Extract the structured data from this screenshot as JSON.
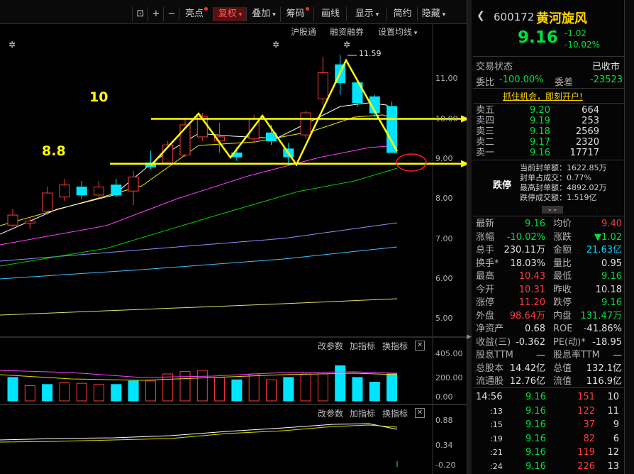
{
  "toolbar": {
    "items": [
      {
        "label": "亮点",
        "dot": true
      },
      {
        "label": "复权",
        "dropdown": true,
        "active": true
      },
      {
        "label": "叠加",
        "dropdown": true
      },
      {
        "label": "筹码",
        "dot": true
      },
      {
        "label": "画线"
      },
      {
        "label": "显示",
        "dropdown": true
      },
      {
        "label": "简约"
      },
      {
        "label": "隐藏",
        "dropdown": true
      }
    ],
    "subbar": [
      "沪股通",
      "融资融券",
      "设置均线"
    ]
  },
  "annotations": {
    "label_10": "10",
    "label_88": "8.8",
    "peak": "11.59"
  },
  "price_axis": [
    "11.00",
    "10.00",
    "9.00",
    "8.00",
    "7.00",
    "6.00",
    "5.00"
  ],
  "volume_panel": {
    "buttons": [
      "改参数",
      "加指标",
      "换指标"
    ],
    "axis": [
      "405.00",
      "200.00",
      "0.00"
    ]
  },
  "indicator_panel": {
    "buttons": [
      "改参数",
      "加指标",
      "换指标"
    ],
    "axis": [
      "0.88",
      "0.34",
      "-0.20"
    ]
  },
  "stock": {
    "code": "600172",
    "name": "黄河旋风",
    "price": "9.16",
    "change": "-1.02",
    "change_pct": "-10.02%",
    "status_label": "交易状态",
    "status": "已收市",
    "weibi_label": "委比",
    "weibi": "-100.00%",
    "weicha_label": "委差",
    "weicha": "-23523",
    "promo": "抓住机会，即刻开户!"
  },
  "order_book": {
    "asks": [
      {
        "label": "卖五",
        "price": "9.20",
        "vol": "664"
      },
      {
        "label": "卖四",
        "price": "9.19",
        "vol": "253"
      },
      {
        "label": "卖三",
        "price": "9.18",
        "vol": "2569"
      },
      {
        "label": "卖二",
        "price": "9.17",
        "vol": "2320"
      },
      {
        "label": "卖一",
        "price": "9.16",
        "vol": "17717"
      }
    ]
  },
  "limit_down": {
    "title": "跌停",
    "rows": [
      {
        "label": "当前封单额：",
        "value": "1622.85万"
      },
      {
        "label": "封单占成交：",
        "value": "0.77%"
      },
      {
        "label": "最高封单额：",
        "value": "4892.02万"
      },
      {
        "label": "跌停成交额：",
        "value": "1.519亿"
      }
    ]
  },
  "quote": [
    {
      "l1": "最新",
      "v1": "9.16",
      "c1": "green",
      "l2": "均价",
      "v2": "9.40",
      "c2": "red"
    },
    {
      "l1": "涨幅",
      "v1": "-10.02%",
      "c1": "green",
      "l2": "涨跌",
      "v2": "▼1.02",
      "c2": "green"
    },
    {
      "l1": "总手",
      "v1": "230.11万",
      "c1": "wht",
      "l2": "金额",
      "v2": "21.63亿",
      "c2": "cyan"
    },
    {
      "l1": "换手*",
      "v1": "18.03%",
      "c1": "wht",
      "l2": "量比",
      "v2": "0.95",
      "c2": "wht"
    },
    {
      "l1": "最高",
      "v1": "10.43",
      "c1": "red",
      "l2": "最低",
      "v2": "9.16",
      "c2": "green"
    },
    {
      "l1": "今开",
      "v1": "10.31",
      "c1": "red",
      "l2": "昨收",
      "v2": "10.18",
      "c2": "wht"
    },
    {
      "l1": "涨停",
      "v1": "11.20",
      "c1": "red",
      "l2": "跌停",
      "v2": "9.16",
      "c2": "green"
    },
    {
      "l1": "外盘",
      "v1": "98.64万",
      "c1": "red",
      "l2": "内盘",
      "v2": "131.47万",
      "c2": "green"
    },
    {
      "l1": "净资产",
      "v1": "0.68",
      "c1": "wht",
      "l2": "ROE",
      "v2": "-41.86%",
      "c2": "wht"
    },
    {
      "l1": "收益(三)",
      "v1": "-0.362",
      "c1": "wht",
      "l2": "PE(动)*",
      "v2": "-18.95",
      "c2": "wht"
    },
    {
      "l1": "股息TTM",
      "v1": "—",
      "c1": "wht",
      "l2": "股息率TTM",
      "v2": "—",
      "c2": "wht"
    },
    {
      "l1": "总股本",
      "v1": "14.42亿",
      "c1": "wht",
      "l2": "总值",
      "v2": "132.1亿",
      "c2": "wht"
    },
    {
      "l1": "流通股",
      "v1": "12.76亿",
      "c1": "wht",
      "l2": "流值",
      "v2": "116.9亿",
      "c2": "wht"
    }
  ],
  "ticks": [
    {
      "time": "14:56",
      "price": "9.16",
      "vol": "151",
      "n": "10"
    },
    {
      "time": ":13",
      "price": "9.16",
      "vol": "122",
      "n": "11"
    },
    {
      "time": ":15",
      "price": "9.16",
      "vol": "37",
      "n": "9"
    },
    {
      "time": ":19",
      "price": "9.16",
      "vol": "82",
      "n": "6"
    },
    {
      "time": ":21",
      "price": "9.16",
      "vol": "119",
      "n": "12"
    },
    {
      "time": ":24",
      "price": "9.16",
      "vol": "226",
      "n": "13"
    }
  ],
  "colors": {
    "up": "#ff3b3b",
    "down": "#00e5ff",
    "annotation": "#ffff00",
    "ma5": "#ffffff",
    "ma10": "#e8e800",
    "ma20": "#ff40ff",
    "ma30": "#00d000",
    "ma60": "#9090ff",
    "ma120": "#40c0ff",
    "ma250": "#e0e070"
  },
  "chart_data": {
    "type": "candlestick",
    "ylim": [
      4.6,
      12.2
    ],
    "candles": [
      {
        "o": 7.35,
        "c": 7.6,
        "h": 7.75,
        "l": 7.3
      },
      {
        "o": 7.4,
        "c": 7.45,
        "h": 7.55,
        "l": 7.25
      },
      {
        "o": 7.7,
        "c": 8.15,
        "h": 8.3,
        "l": 7.6
      },
      {
        "o": 8.05,
        "c": 8.35,
        "h": 8.5,
        "l": 7.95
      },
      {
        "o": 8.3,
        "c": 8.1,
        "h": 8.45,
        "l": 8.0
      },
      {
        "o": 8.1,
        "c": 8.3,
        "h": 8.45,
        "l": 8.05
      },
      {
        "o": 8.35,
        "c": 8.1,
        "h": 8.5,
        "l": 8.05
      },
      {
        "o": 8.2,
        "c": 8.55,
        "h": 8.7,
        "l": 7.85
      },
      {
        "o": 8.9,
        "c": 8.8,
        "h": 9.2,
        "l": 8.75
      },
      {
        "o": 8.9,
        "c": 9.35,
        "h": 9.45,
        "l": 8.85
      },
      {
        "o": 9.1,
        "c": 9.85,
        "h": 10.0,
        "l": 9.05
      },
      {
        "o": 9.55,
        "c": 10.05,
        "h": 10.15,
        "l": 9.45
      },
      {
        "o": 9.45,
        "c": 9.55,
        "h": 9.9,
        "l": 9.15
      },
      {
        "o": 9.15,
        "c": 9.05,
        "h": 9.3,
        "l": 8.95
      },
      {
        "o": 9.5,
        "c": 10.0,
        "h": 10.1,
        "l": 9.4
      },
      {
        "o": 9.65,
        "c": 9.45,
        "h": 9.85,
        "l": 9.35
      },
      {
        "o": 9.25,
        "c": 9.05,
        "h": 9.4,
        "l": 8.85
      },
      {
        "o": 9.6,
        "c": 10.15,
        "h": 10.2,
        "l": 9.5
      },
      {
        "o": 10.5,
        "c": 11.15,
        "h": 11.55,
        "l": 10.35
      },
      {
        "o": 11.35,
        "c": 10.9,
        "h": 11.59,
        "l": 10.6
      },
      {
        "o": 10.9,
        "c": 10.4,
        "h": 10.95,
        "l": 10.3
      },
      {
        "o": 10.55,
        "c": 10.15,
        "h": 10.6,
        "l": 10.05
      },
      {
        "o": 10.31,
        "c": 9.16,
        "h": 10.43,
        "l": 9.16
      }
    ],
    "volume": [
      {
        "v": 200,
        "up": false
      },
      {
        "v": 130,
        "up": true
      },
      {
        "v": 140,
        "up": false
      },
      {
        "v": 155,
        "up": true
      },
      {
        "v": 150,
        "up": true
      },
      {
        "v": 140,
        "up": true
      },
      {
        "v": 140,
        "up": false
      },
      {
        "v": 170,
        "up": false
      },
      {
        "v": 170,
        "up": true
      },
      {
        "v": 230,
        "up": true
      },
      {
        "v": 250,
        "up": true
      },
      {
        "v": 260,
        "up": true
      },
      {
        "v": 200,
        "up": true
      },
      {
        "v": 180,
        "up": false
      },
      {
        "v": 230,
        "up": true
      },
      {
        "v": 180,
        "up": true
      },
      {
        "v": 200,
        "up": false
      },
      {
        "v": 230,
        "up": true
      },
      {
        "v": 230,
        "up": true
      },
      {
        "v": 300,
        "up": false
      },
      {
        "v": 200,
        "up": false
      },
      {
        "v": 160,
        "up": false
      },
      {
        "v": 230,
        "up": false
      }
    ],
    "volume_ylim": [
      0,
      405
    ],
    "trend_upper": 10.0,
    "trend_lower": 8.88
  }
}
